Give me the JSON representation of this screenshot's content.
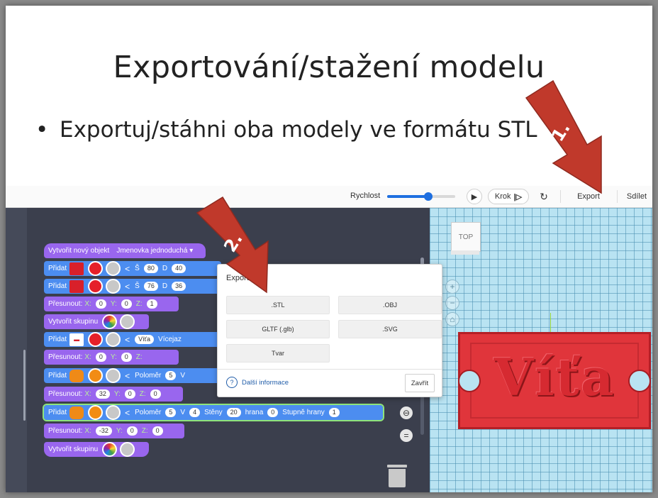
{
  "slide": {
    "title": "Exportování/stažení modelu",
    "bullet": "Exportuj/stáhni oba modely ve formátu STL",
    "arrow1_label": "1.",
    "arrow2_label": "2."
  },
  "toolbar": {
    "speed_label": "Rychlost",
    "speed_value": 0.6,
    "step_label": "Krok",
    "export_label": "Export",
    "share_label": "Sdílet"
  },
  "blocks": {
    "create_object": "Vytvořit nový objekt",
    "object_name": "Jmenovka jednoduchá ▾",
    "add": "Přidat",
    "move": "Přesunout:",
    "group": "Vytvořit skupinu",
    "row1": {
      "s_label": "Š",
      "s_val": "80",
      "d_label": "D",
      "d_val": "40"
    },
    "row2": {
      "s_label": "Š",
      "s_val": "76",
      "d_label": "D",
      "d_val": "36"
    },
    "move1": {
      "x": "0",
      "y": "0",
      "z": "1"
    },
    "text_row": {
      "text": "Víťa",
      "extra": "Vícejaz"
    },
    "move2": {
      "x": "0",
      "y": "0",
      "z": ""
    },
    "cyl1": {
      "radius_label": "Poloměr",
      "radius": "5",
      "v_label": "V"
    },
    "move3": {
      "x": "32",
      "y": "0",
      "z": "0"
    },
    "cyl2": {
      "radius_label": "Poloměr",
      "radius": "5",
      "v_label": "V",
      "v": "4",
      "walls_label": "Stěny",
      "walls": "20",
      "edge_label": "hrana",
      "edge": "0",
      "degree_label": "Stupně hrany",
      "degree": "1"
    },
    "move4": {
      "x": "-32",
      "y": "0",
      "z": "0"
    },
    "x_label": "X:",
    "y_label": "Y:",
    "z_label": "Z:"
  },
  "dialog": {
    "title": "Export",
    "options": [
      ".STL",
      ".OBJ",
      "GLTF (.glb)",
      ".SVG",
      "Tvar"
    ],
    "info": "Další informace",
    "close": "Zavřít"
  },
  "scene": {
    "viewcube_label": "TOP",
    "model_text": "Víťa",
    "plate_color": "#e0353b"
  },
  "colors": {
    "accent": "#1e6fe0",
    "block_purple": "#9966ee",
    "block_blue": "#4c8df0",
    "arrow": "#c0392b"
  }
}
